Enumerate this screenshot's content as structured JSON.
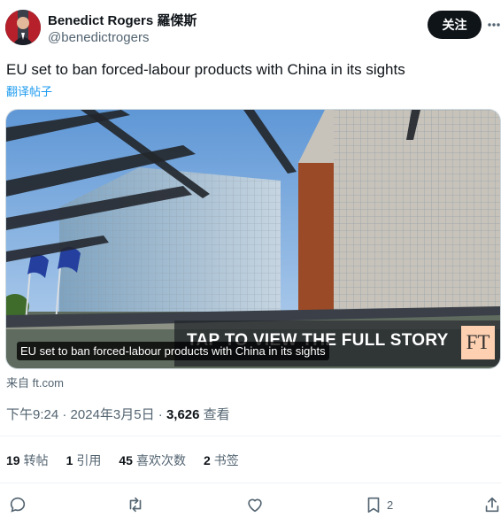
{
  "author": {
    "name": "Benedict Rogers 羅傑斯",
    "handle": "@benedictrogers",
    "follow_label": "关注"
  },
  "tweet": {
    "text": "EU set to ban forced-labour products with China in its sights",
    "translate_label": "翻译帖子"
  },
  "card": {
    "banner_text": "TAP TO VIEW THE FULL STORY",
    "logo_text": "FT",
    "caption": "EU set to ban forced-labour products with China in its sights",
    "source": "来自 ft.com"
  },
  "meta": {
    "time": "下午9:24",
    "separator": "·",
    "date": "2024年3月5日",
    "views_count": "3,626",
    "views_label": "查看"
  },
  "stats": [
    {
      "count": "19",
      "label": "转帖"
    },
    {
      "count": "1",
      "label": "引用"
    },
    {
      "count": "45",
      "label": "喜欢次数"
    },
    {
      "count": "2",
      "label": "书签"
    }
  ],
  "actions": {
    "reply_icon": "reply-icon",
    "retweet_icon": "retweet-icon",
    "like_icon": "heart-icon",
    "bookmark_icon": "bookmark-icon",
    "bookmark_count": "2",
    "share_icon": "share-icon"
  },
  "colors": {
    "accent": "#1d9bf0",
    "text_primary": "#0f1419",
    "text_secondary": "#536471",
    "follow_bg": "#0f1419"
  }
}
